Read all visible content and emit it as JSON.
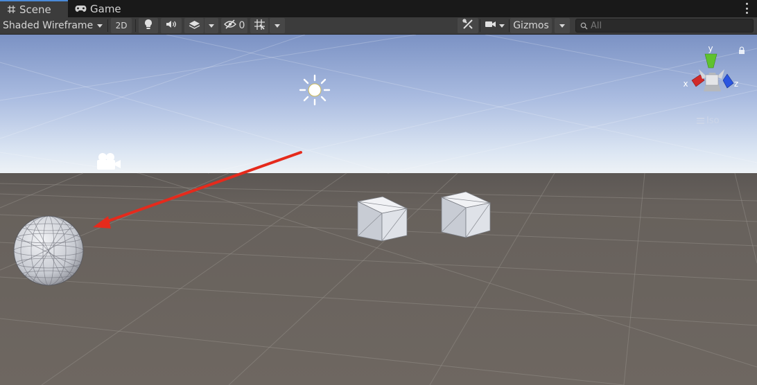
{
  "tabs": [
    {
      "label": "Scene",
      "icon": "grid-hash-icon",
      "active": true
    },
    {
      "label": "Game",
      "icon": "gamepad-icon",
      "active": false
    }
  ],
  "toolbar": {
    "draw_mode": "Shaded Wireframe",
    "mode_2d": "2D",
    "lighting_icon": "lightbulb-icon",
    "audio_icon": "speaker-icon",
    "effects_icon": "effects-layers-icon",
    "hidden_count": "0",
    "grid_icon": "grid-snap-icon",
    "tools_icon": "tools-icon",
    "camera_icon": "camera-icon",
    "gizmos_label": "Gizmos",
    "search_placeholder": "All"
  },
  "viewport": {
    "axis_labels": {
      "x": "x",
      "y": "y",
      "z": "z"
    },
    "projection_label": "Iso",
    "sky_top": "#7b92c4",
    "horizon": "#dce6f3",
    "ground": "#6b645e",
    "arrow_color": "#e52a1c",
    "axis_colors": {
      "x": "#d12a2a",
      "y": "#5fc22e",
      "z": "#2a55e0"
    }
  }
}
